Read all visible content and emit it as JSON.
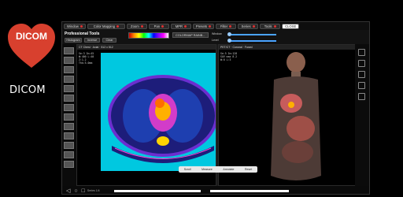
{
  "brand": {
    "logo_text": "DICOM",
    "app_name": "DICOM",
    "logo_color": "#d8402e"
  },
  "toolbar": {
    "buttons": [
      {
        "label": "Window",
        "has_dot": true
      },
      {
        "label": "Color Mapping",
        "has_dot": true
      },
      {
        "label": "Zoom",
        "has_dot": true
      },
      {
        "label": "Pan",
        "has_dot": true
      },
      {
        "label": "MPR",
        "has_dot": true
      },
      {
        "label": "Presets",
        "has_dot": true
      },
      {
        "label": "Filter",
        "has_dot": true
      },
      {
        "label": "Series",
        "has_dot": true
      },
      {
        "label": "Tools",
        "has_dot": true
      }
    ],
    "close_label": "CLOSE"
  },
  "pro_tools": {
    "title": "Professional Tools",
    "buttons": [
      "Histogram",
      "Inverse",
      "Clear"
    ],
    "colormap_label": "COLORMAP RAINB...",
    "window_label": "Window",
    "level_label": "Level"
  },
  "viewport_left": {
    "header": "CT Chest · Axial · 512 x 512",
    "info_lines": [
      "Se:3 Im:45",
      "W:400 L:40",
      "Z:1.2",
      "Thk:5.0mm"
    ]
  },
  "viewport_right": {
    "header": "PET/CT · Coronal · Fused",
    "info_lines": [
      "Se:5 Im:128",
      "SUV max 8.2",
      "W:6 L:3"
    ]
  },
  "float_toolbar": {
    "items": [
      "Scroll",
      "Measure",
      "Annotate",
      "Reset"
    ]
  },
  "bottom": {
    "status": "Series 1/4"
  },
  "colors": {
    "ct_bg": "#00c8e0",
    "accent": "#4aa3ff"
  }
}
